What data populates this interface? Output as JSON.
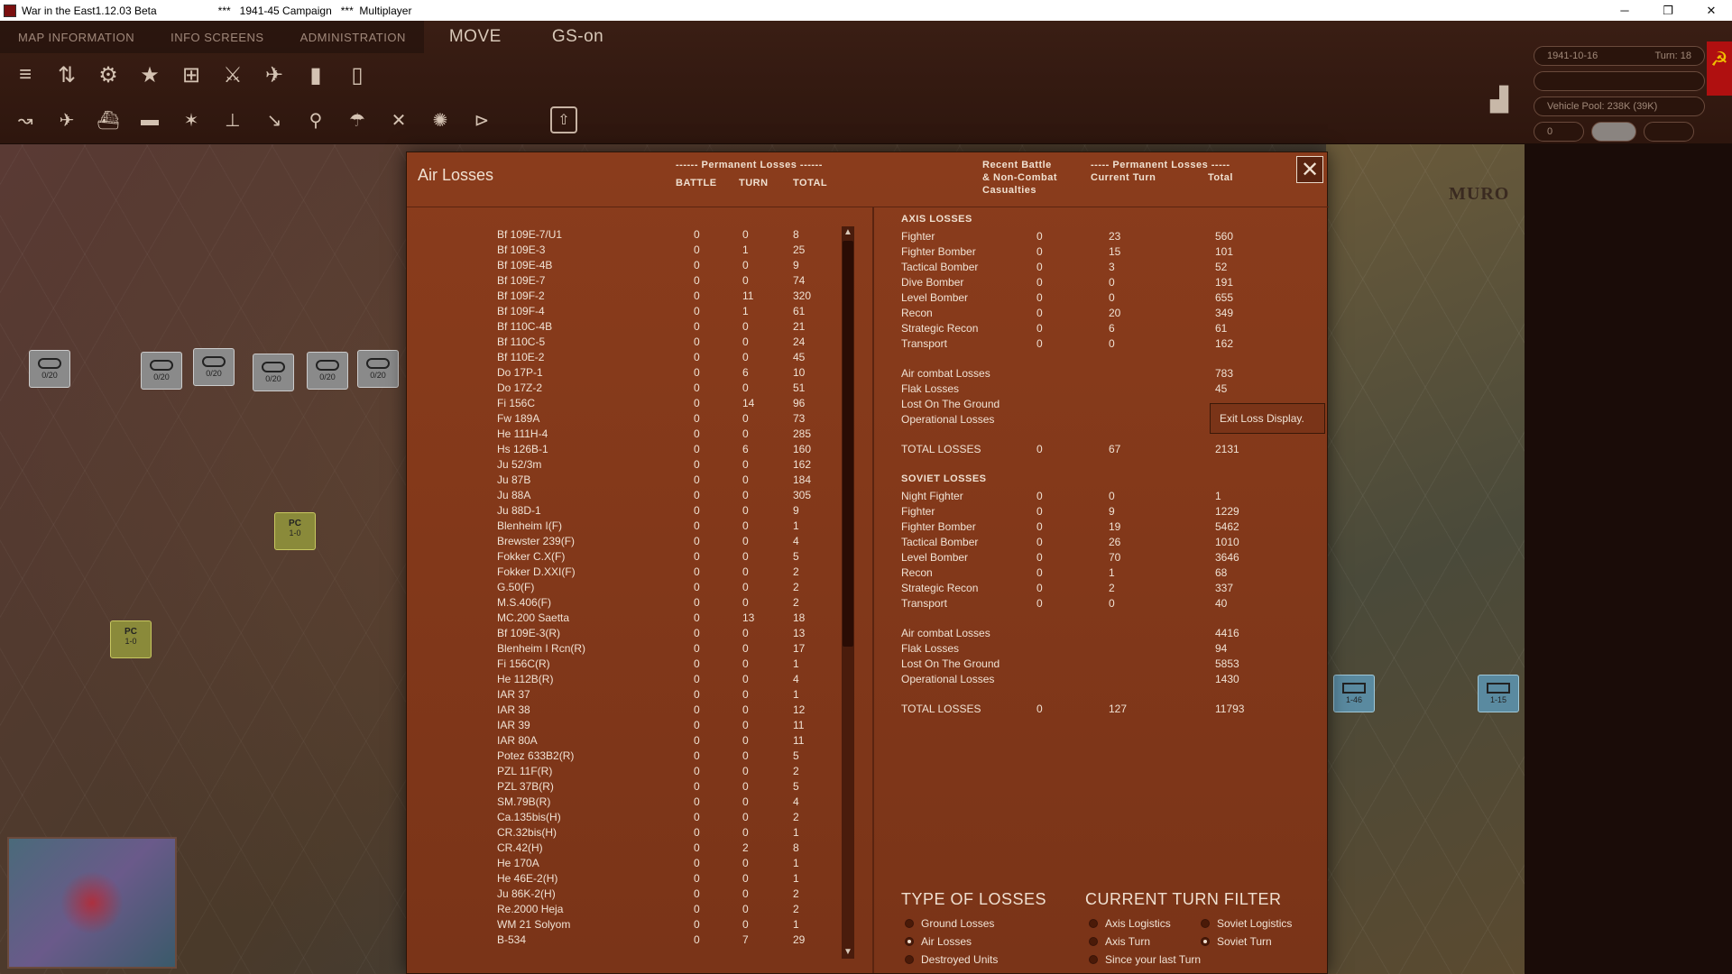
{
  "window": {
    "title": "War in the East1.12.03 Beta",
    "campaign": "***   1941-45 Campaign   ***  Multiplayer",
    "minimize": "─",
    "restore": "❐",
    "close": "✕"
  },
  "menu": {
    "map_information": "MAP INFORMATION",
    "info_screens": "INFO SCREENS",
    "administration": "ADMINISTRATION",
    "move": "MOVE",
    "gs_on": "GS-on"
  },
  "status": {
    "date": "1941-10-16",
    "turn": "Turn: 18",
    "vehicle_pool": "Vehicle Pool: 238K (39K)",
    "counter_value": "0"
  },
  "map": {
    "city_label": "MURO",
    "counter_labels": [
      "0/20",
      "0/20",
      "0/20",
      "0/20",
      "0/20",
      "0/20"
    ],
    "pc_label": "PC",
    "pc_value": "1-0",
    "sov_values": [
      "1-46",
      "1-15"
    ]
  },
  "dialog": {
    "title": "Air Losses",
    "perm_losses_header": "------ Permanent Losses ------",
    "col_battle": "BATTLE",
    "col_turn": "TURN",
    "col_total": "TOTAL",
    "recent_battle_header": "Recent Battle",
    "non_combat_header": "& Non-Combat",
    "casualties_header": "Casualties",
    "perm_losses_header2": "----- Permanent Losses -----",
    "current_turn_header": "Current Turn",
    "total_header": "Total",
    "close_label": "✕",
    "exit_tooltip": "Exit Loss Display."
  },
  "left_rows": [
    [
      "Bf 109E-7/U1",
      "0",
      "0",
      "8"
    ],
    [
      "Bf 109E-3",
      "0",
      "1",
      "25"
    ],
    [
      "Bf 109E-4B",
      "0",
      "0",
      "9"
    ],
    [
      "Bf 109E-7",
      "0",
      "0",
      "74"
    ],
    [
      "Bf 109F-2",
      "0",
      "11",
      "320"
    ],
    [
      "Bf 109F-4",
      "0",
      "1",
      "61"
    ],
    [
      "Bf 110C-4B",
      "0",
      "0",
      "21"
    ],
    [
      "Bf 110C-5",
      "0",
      "0",
      "24"
    ],
    [
      "Bf 110E-2",
      "0",
      "0",
      "45"
    ],
    [
      "Do 17P-1",
      "0",
      "6",
      "10"
    ],
    [
      "Do 17Z-2",
      "0",
      "0",
      "51"
    ],
    [
      "Fi 156C",
      "0",
      "14",
      "96"
    ],
    [
      "Fw 189A",
      "0",
      "0",
      "73"
    ],
    [
      "He 111H-4",
      "0",
      "0",
      "285"
    ],
    [
      "Hs 126B-1",
      "0",
      "6",
      "160"
    ],
    [
      "Ju 52/3m",
      "0",
      "0",
      "162"
    ],
    [
      "Ju 87B",
      "0",
      "0",
      "184"
    ],
    [
      "Ju 88A",
      "0",
      "0",
      "305"
    ],
    [
      "Ju 88D-1",
      "0",
      "0",
      "9"
    ],
    [
      "Blenheim I(F)",
      "0",
      "0",
      "1"
    ],
    [
      "Brewster 239(F)",
      "0",
      "0",
      "4"
    ],
    [
      "Fokker C.X(F)",
      "0",
      "0",
      "5"
    ],
    [
      "Fokker D.XXI(F)",
      "0",
      "0",
      "2"
    ],
    [
      "G.50(F)",
      "0",
      "0",
      "2"
    ],
    [
      "M.S.406(F)",
      "0",
      "0",
      "2"
    ],
    [
      "MC.200 Saetta",
      "0",
      "13",
      "18"
    ],
    [
      "Bf 109E-3(R)",
      "0",
      "0",
      "13"
    ],
    [
      "Blenheim I Rcn(R)",
      "0",
      "0",
      "17"
    ],
    [
      "Fi 156C(R)",
      "0",
      "0",
      "1"
    ],
    [
      "He 112B(R)",
      "0",
      "0",
      "4"
    ],
    [
      "IAR 37",
      "0",
      "0",
      "1"
    ],
    [
      "IAR 38",
      "0",
      "0",
      "12"
    ],
    [
      "IAR 39",
      "0",
      "0",
      "11"
    ],
    [
      "IAR 80A",
      "0",
      "0",
      "11"
    ],
    [
      "Potez 633B2(R)",
      "0",
      "0",
      "5"
    ],
    [
      "PZL 11F(R)",
      "0",
      "0",
      "2"
    ],
    [
      "PZL 37B(R)",
      "0",
      "0",
      "5"
    ],
    [
      "SM.79B(R)",
      "0",
      "0",
      "4"
    ],
    [
      "Ca.135bis(H)",
      "0",
      "0",
      "2"
    ],
    [
      "CR.32bis(H)",
      "0",
      "0",
      "1"
    ],
    [
      "CR.42(H)",
      "0",
      "2",
      "8"
    ],
    [
      "He 170A",
      "0",
      "0",
      "1"
    ],
    [
      "He 46E-2(H)",
      "0",
      "0",
      "1"
    ],
    [
      "Ju 86K-2(H)",
      "0",
      "0",
      "2"
    ],
    [
      "Re.2000 Heja",
      "0",
      "0",
      "2"
    ],
    [
      "WM 21 Solyom",
      "0",
      "0",
      "1"
    ],
    [
      "B-534",
      "0",
      "7",
      "29"
    ]
  ],
  "axis": {
    "title": "AXIS LOSSES",
    "rows": [
      [
        "Fighter",
        "0",
        "23",
        "560"
      ],
      [
        "Fighter Bomber",
        "0",
        "15",
        "101"
      ],
      [
        "Tactical Bomber",
        "0",
        "3",
        "52"
      ],
      [
        "Dive Bomber",
        "0",
        "0",
        "191"
      ],
      [
        "Level Bomber",
        "0",
        "0",
        "655"
      ],
      [
        "Recon",
        "0",
        "20",
        "349"
      ],
      [
        "Strategic Recon",
        "0",
        "6",
        "61"
      ],
      [
        "Transport",
        "0",
        "0",
        "162"
      ]
    ],
    "summary": [
      [
        "Air combat Losses",
        "783"
      ],
      [
        "Flak Losses",
        "45"
      ],
      [
        "Lost On The Ground",
        ""
      ],
      [
        "Operational Losses",
        ""
      ]
    ],
    "total": [
      "TOTAL LOSSES",
      "0",
      "67",
      "2131"
    ]
  },
  "soviet": {
    "title": "SOVIET LOSSES",
    "rows": [
      [
        "Night Fighter",
        "0",
        "0",
        "1"
      ],
      [
        "Fighter",
        "0",
        "9",
        "1229"
      ],
      [
        "Fighter Bomber",
        "0",
        "19",
        "5462"
      ],
      [
        "Tactical Bomber",
        "0",
        "26",
        "1010"
      ],
      [
        "Level Bomber",
        "0",
        "70",
        "3646"
      ],
      [
        "Recon",
        "0",
        "1",
        "68"
      ],
      [
        "Strategic Recon",
        "0",
        "2",
        "337"
      ],
      [
        "Transport",
        "0",
        "0",
        "40"
      ]
    ],
    "summary": [
      [
        "Air combat Losses",
        "4416"
      ],
      [
        "Flak Losses",
        "94"
      ],
      [
        "Lost On The Ground",
        "5853"
      ],
      [
        "Operational Losses",
        "1430"
      ]
    ],
    "total": [
      "TOTAL LOSSES",
      "0",
      "127",
      "11793"
    ]
  },
  "filters": {
    "type_title": "TYPE OF LOSSES",
    "type_options": [
      "Ground Losses",
      "Air Losses",
      "Destroyed Units"
    ],
    "type_selected": 1,
    "turn_title": "CURRENT TURN FILTER",
    "turn_left": [
      "Axis Logistics",
      "Axis Turn",
      "Since your last Turn"
    ],
    "turn_right": [
      "Soviet Logistics",
      "Soviet Turn"
    ],
    "turn_selected": "Soviet Turn"
  },
  "icons": {
    "toolbar_row1": [
      "layers-icon",
      "sliders-icon",
      "gear-icon",
      "star-icon",
      "unit-icon",
      "crossed-swords-icon",
      "airstrike-icon",
      "fuel-icon",
      "supply-icon"
    ],
    "toolbar_row2": [
      "move-icon",
      "aircraft-icon",
      "ship-icon",
      "airfield-icon",
      "bomb-icon",
      "land-icon",
      "dive-icon",
      "recon-icon",
      "paradrop-icon",
      "interdict-icon",
      "flak-icon",
      "play-icon",
      "upload-icon"
    ]
  },
  "colors": {
    "dialog_bg": "#8a3c1c",
    "text": "#f0e2d4",
    "soviet_flag": "#b01010"
  }
}
